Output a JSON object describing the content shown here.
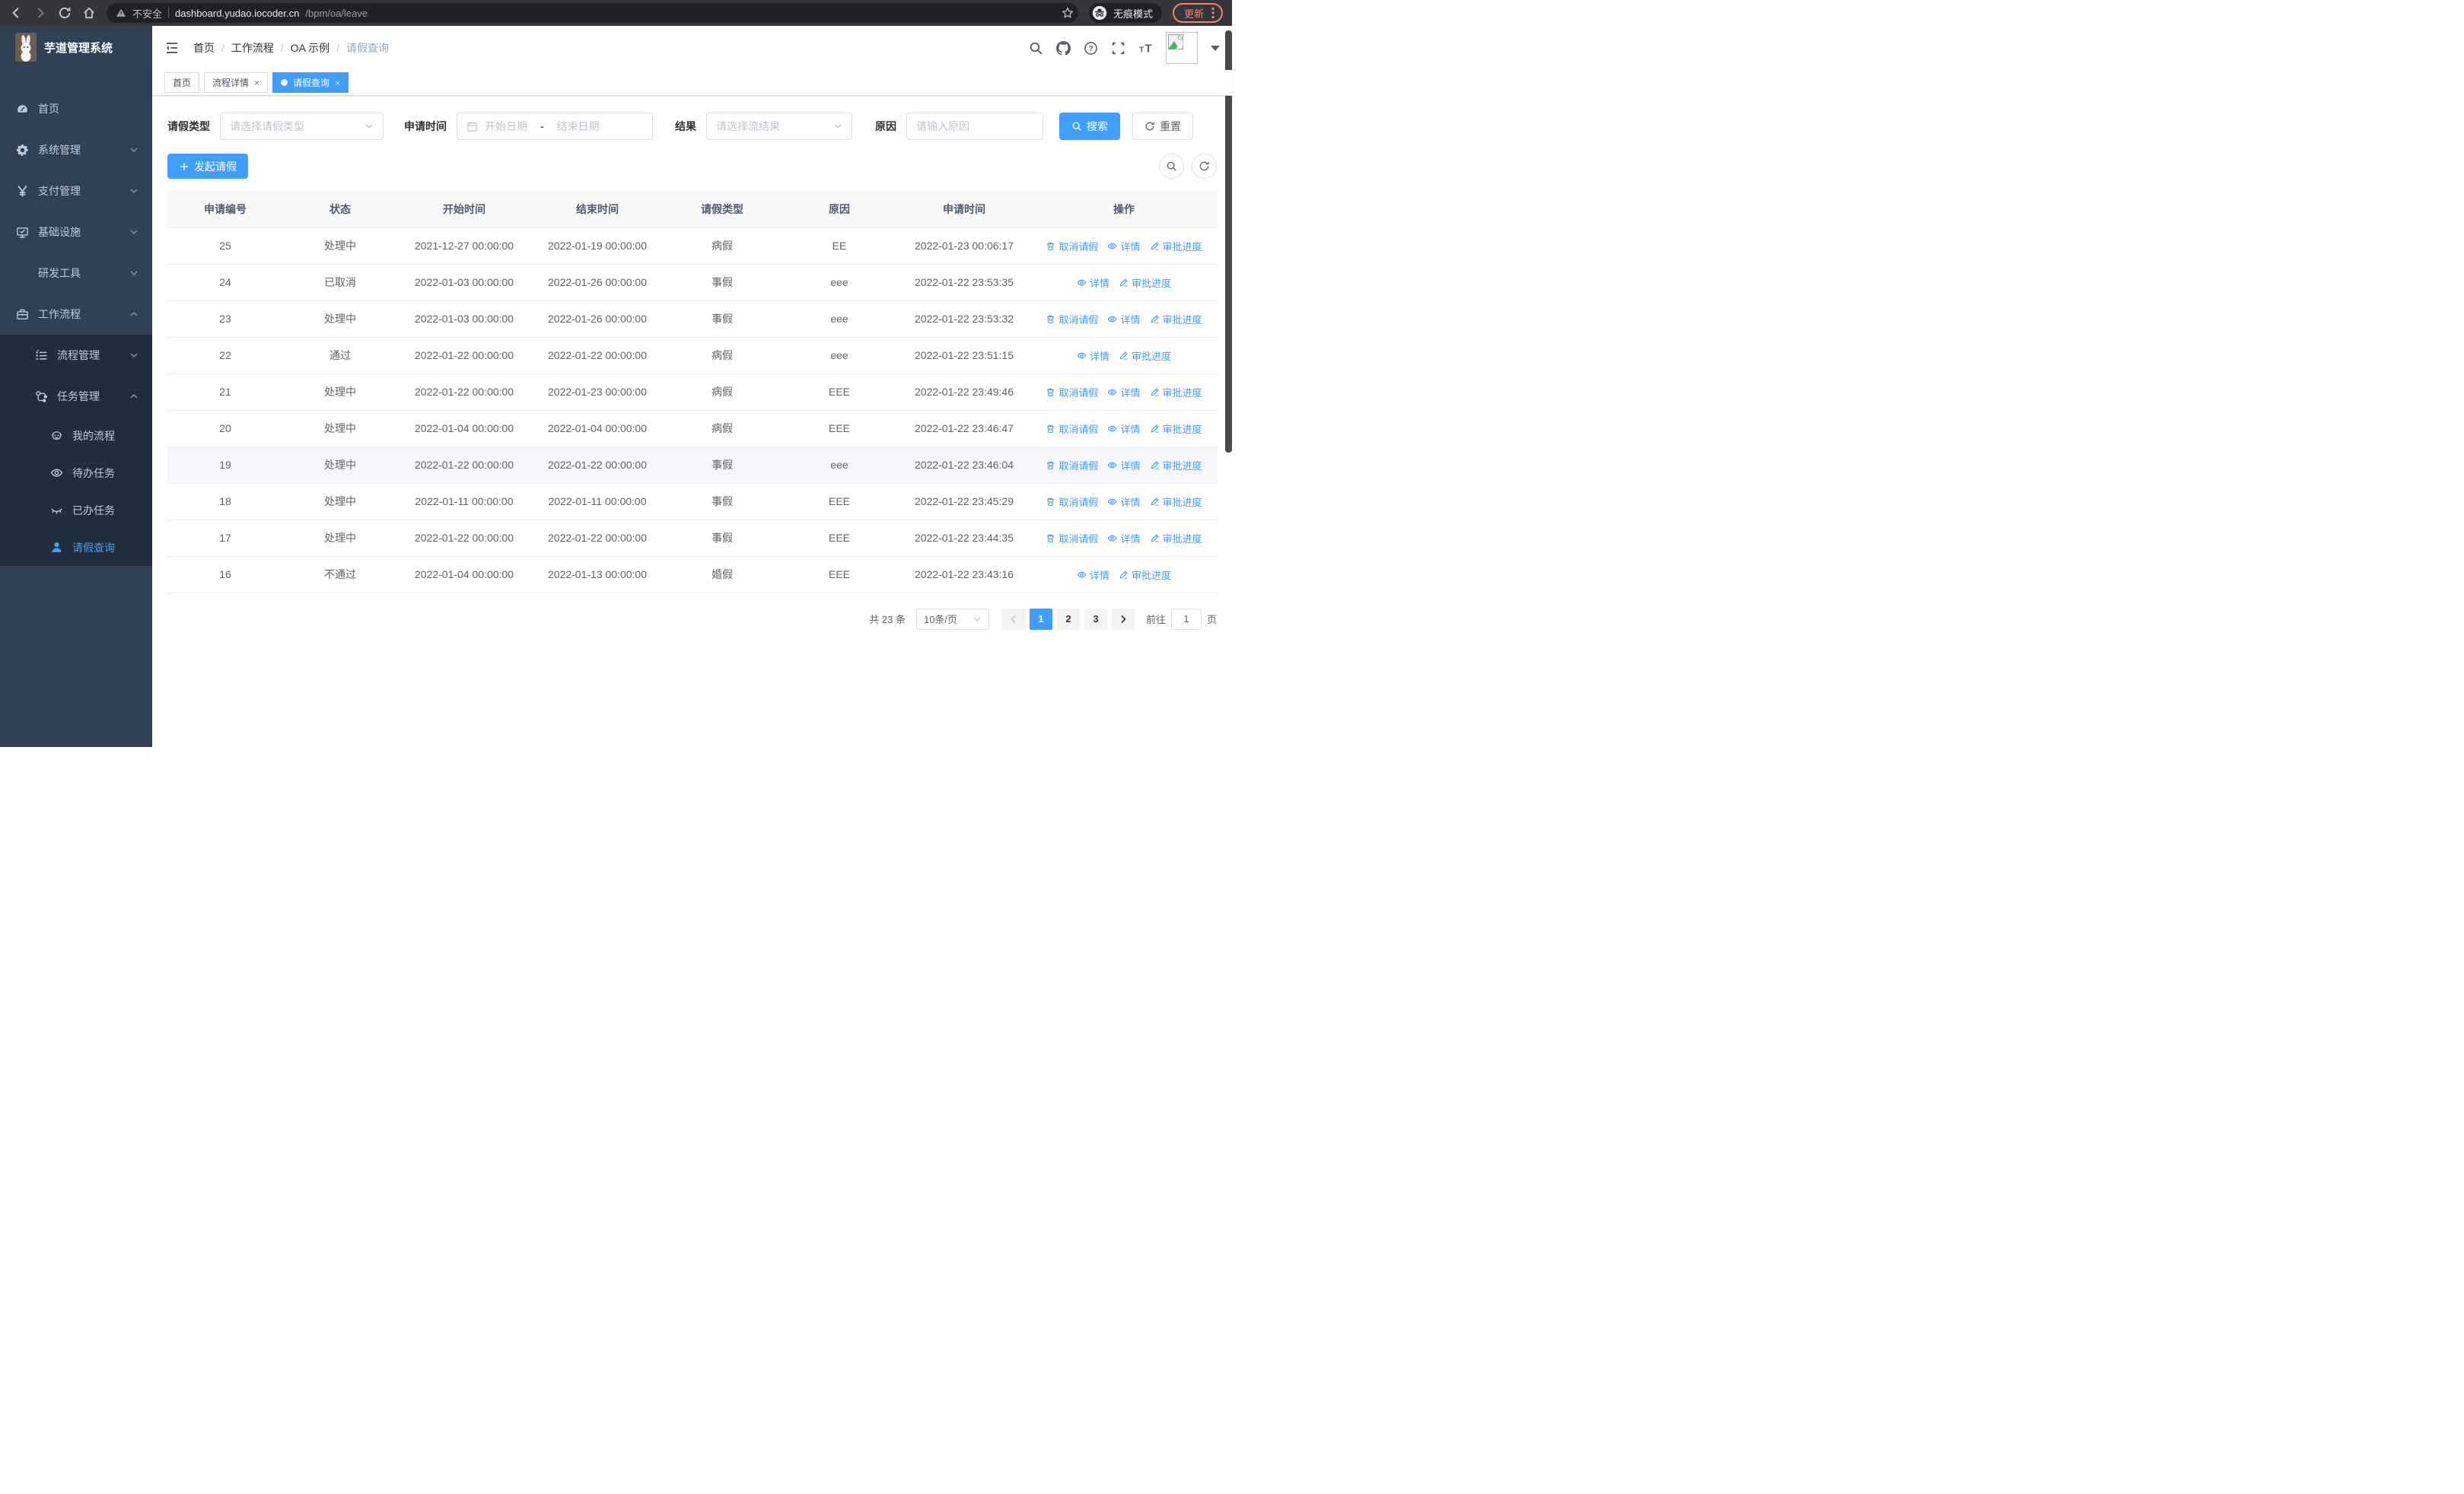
{
  "browser": {
    "security_label": "不安全",
    "url_host": "dashboard.yudao.iocoder.cn",
    "url_path": "/bpm/oa/leave",
    "incognito_label": "无痕模式",
    "update_label": "更新"
  },
  "sidebar": {
    "title": "芋道管理系统",
    "items": [
      {
        "key": "home",
        "label": "首页",
        "icon": "dashboard-icon",
        "type": "top",
        "chevron": ""
      },
      {
        "key": "system",
        "label": "系统管理",
        "icon": "gear-icon",
        "type": "top",
        "chevron": "down"
      },
      {
        "key": "payment",
        "label": "支付管理",
        "icon": "yen-icon",
        "type": "top",
        "chevron": "down"
      },
      {
        "key": "infra",
        "label": "基础设施",
        "icon": "monitor-icon",
        "type": "top",
        "chevron": "down"
      },
      {
        "key": "devtools",
        "label": "研发工具",
        "icon": "toolbox-icon",
        "type": "top",
        "chevron": "down"
      },
      {
        "key": "workflow",
        "label": "工作流程",
        "icon": "briefcase-icon",
        "type": "top",
        "chevron": "up"
      },
      {
        "key": "process-mgmt",
        "label": "流程管理",
        "icon": "list-icon",
        "type": "sub",
        "chevron": "down"
      },
      {
        "key": "task-mgmt",
        "label": "任务管理",
        "icon": "flow-icon",
        "type": "sub",
        "chevron": "up"
      },
      {
        "key": "my-process",
        "label": "我的流程",
        "icon": "robot-icon",
        "type": "leaf",
        "chevron": ""
      },
      {
        "key": "todo-tasks",
        "label": "待办任务",
        "icon": "eye-icon",
        "type": "leaf",
        "chevron": ""
      },
      {
        "key": "done-tasks",
        "label": "已办任务",
        "icon": "eye-closed-icon",
        "type": "leaf",
        "chevron": ""
      },
      {
        "key": "leave-query",
        "label": "请假查询",
        "icon": "user-icon",
        "type": "leaf",
        "chevron": "",
        "active": true
      }
    ]
  },
  "navbar": {
    "breadcrumb": [
      "首页",
      "工作流程",
      "OA 示例",
      "请假查询"
    ]
  },
  "tabs": [
    {
      "key": "home",
      "label": "首页",
      "closable": false,
      "active": false
    },
    {
      "key": "process-detail",
      "label": "流程详情",
      "closable": true,
      "active": false
    },
    {
      "key": "leave-query",
      "label": "请假查询",
      "closable": true,
      "active": true
    }
  ],
  "filters": {
    "leave_type_label": "请假类型",
    "leave_type_placeholder": "请选择请假类型",
    "apply_time_label": "申请时间",
    "date_start_placeholder": "开始日期",
    "date_separator": "-",
    "date_end_placeholder": "结束日期",
    "result_label": "结果",
    "result_placeholder": "请选择流结果",
    "reason_label": "原因",
    "reason_placeholder": "请输入原因",
    "search_label": "搜索",
    "reset_label": "重置"
  },
  "toolbar": {
    "create_label": "发起请假"
  },
  "table": {
    "columns": [
      "申请编号",
      "状态",
      "开始时间",
      "结束时间",
      "请假类型",
      "原因",
      "申请时间",
      "操作"
    ],
    "action_labels": {
      "cancel": "取消请假",
      "detail": "详情",
      "progress": "审批进度"
    },
    "rows": [
      {
        "id": "25",
        "status": "处理中",
        "start": "2021-12-27 00:00:00",
        "end": "2022-01-19 00:00:00",
        "type": "病假",
        "reason": "EE",
        "applied": "2022-01-23 00:06:17",
        "actions": [
          "cancel",
          "detail",
          "progress"
        ],
        "highlight": false
      },
      {
        "id": "24",
        "status": "已取消",
        "start": "2022-01-03 00:00:00",
        "end": "2022-01-26 00:00:00",
        "type": "事假",
        "reason": "eee",
        "applied": "2022-01-22 23:53:35",
        "actions": [
          "detail",
          "progress"
        ],
        "highlight": false
      },
      {
        "id": "23",
        "status": "处理中",
        "start": "2022-01-03 00:00:00",
        "end": "2022-01-26 00:00:00",
        "type": "事假",
        "reason": "eee",
        "applied": "2022-01-22 23:53:32",
        "actions": [
          "cancel",
          "detail",
          "progress"
        ],
        "highlight": false
      },
      {
        "id": "22",
        "status": "通过",
        "start": "2022-01-22 00:00:00",
        "end": "2022-01-22 00:00:00",
        "type": "病假",
        "reason": "eee",
        "applied": "2022-01-22 23:51:15",
        "actions": [
          "detail",
          "progress"
        ],
        "highlight": false
      },
      {
        "id": "21",
        "status": "处理中",
        "start": "2022-01-22 00:00:00",
        "end": "2022-01-23 00:00:00",
        "type": "病假",
        "reason": "EEE",
        "applied": "2022-01-22 23:49:46",
        "actions": [
          "cancel",
          "detail",
          "progress"
        ],
        "highlight": false
      },
      {
        "id": "20",
        "status": "处理中",
        "start": "2022-01-04 00:00:00",
        "end": "2022-01-04 00:00:00",
        "type": "病假",
        "reason": "EEE",
        "applied": "2022-01-22 23:46:47",
        "actions": [
          "cancel",
          "detail",
          "progress"
        ],
        "highlight": false
      },
      {
        "id": "19",
        "status": "处理中",
        "start": "2022-01-22 00:00:00",
        "end": "2022-01-22 00:00:00",
        "type": "事假",
        "reason": "eee",
        "applied": "2022-01-22 23:46:04",
        "actions": [
          "cancel",
          "detail",
          "progress"
        ],
        "highlight": true
      },
      {
        "id": "18",
        "status": "处理中",
        "start": "2022-01-11 00:00:00",
        "end": "2022-01-11 00:00:00",
        "type": "事假",
        "reason": "EEE",
        "applied": "2022-01-22 23:45:29",
        "actions": [
          "cancel",
          "detail",
          "progress"
        ],
        "highlight": false
      },
      {
        "id": "17",
        "status": "处理中",
        "start": "2022-01-22 00:00:00",
        "end": "2022-01-22 00:00:00",
        "type": "事假",
        "reason": "EEE",
        "applied": "2022-01-22 23:44:35",
        "actions": [
          "cancel",
          "detail",
          "progress"
        ],
        "highlight": false
      },
      {
        "id": "16",
        "status": "不通过",
        "start": "2022-01-04 00:00:00",
        "end": "2022-01-13 00:00:00",
        "type": "婚假",
        "reason": "EEE",
        "applied": "2022-01-22 23:43:16",
        "actions": [
          "detail",
          "progress"
        ],
        "highlight": false
      }
    ]
  },
  "pagination": {
    "total_label": "共 23 条",
    "page_size": "10条/页",
    "pages": [
      "1",
      "2",
      "3"
    ],
    "active_page": "1",
    "goto_label": "前往",
    "goto_value": "1",
    "page_unit": "页"
  },
  "colors": {
    "accent": "#409eff",
    "sidebar_bg": "#304156",
    "submenu_bg": "#1f2d3d",
    "update": "#ee8277"
  }
}
